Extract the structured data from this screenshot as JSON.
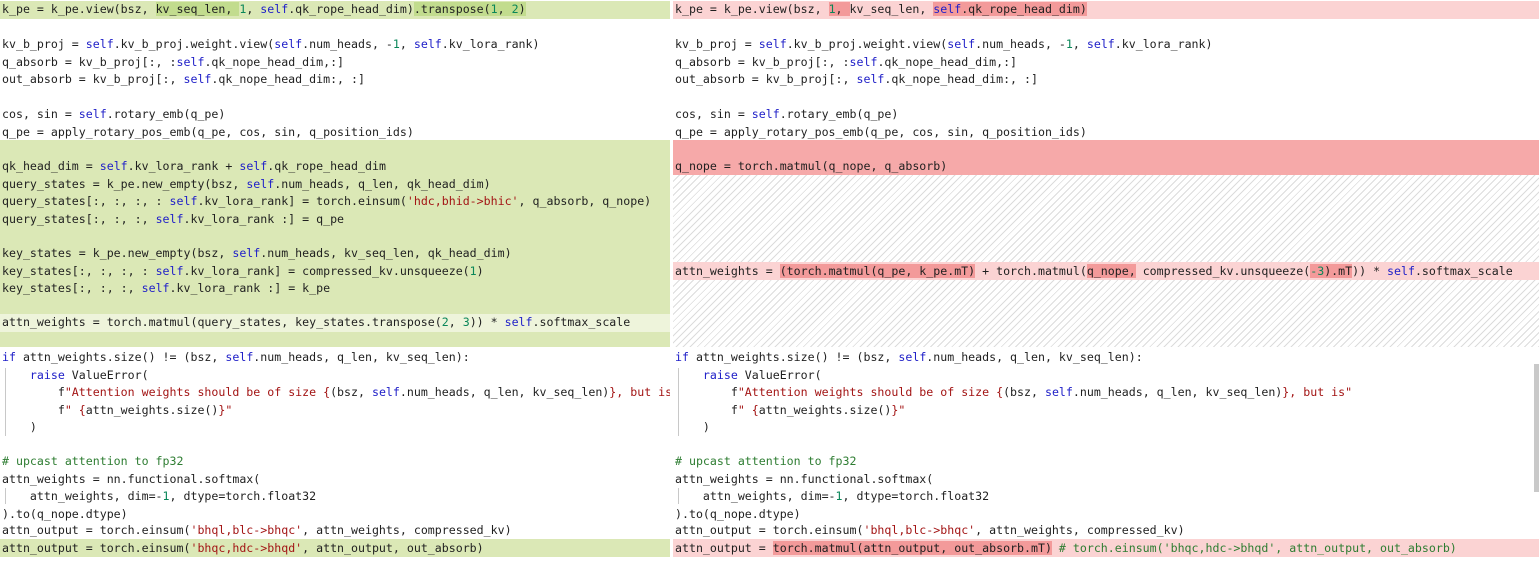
{
  "left_lines": [
    "k_pe = k_pe.view(bsz, kv_seq_len, 1, self.qk_rope_head_dim).transpose(1, 2)",
    "",
    "kv_b_proj = self.kv_b_proj.weight.view(self.num_heads, -1, self.kv_lora_rank)",
    "q_absorb = kv_b_proj[:, :self.qk_nope_head_dim,:]",
    "out_absorb = kv_b_proj[:, self.qk_nope_head_dim:, :]",
    "",
    "cos, sin = self.rotary_emb(q_pe)",
    "q_pe = apply_rotary_pos_emb(q_pe, cos, sin, q_position_ids)",
    "",
    "qk_head_dim = self.kv_lora_rank + self.qk_rope_head_dim",
    "query_states = k_pe.new_empty(bsz, self.num_heads, q_len, qk_head_dim)",
    "query_states[:, :, :, : self.kv_lora_rank] = torch.einsum('hdc,bhid->bhic', q_absorb, q_nope)",
    "query_states[:, :, :, self.kv_lora_rank :] = q_pe",
    "",
    "key_states = k_pe.new_empty(bsz, self.num_heads, kv_seq_len, qk_head_dim)",
    "key_states[:, :, :, : self.kv_lora_rank] = compressed_kv.unsqueeze(1)",
    "key_states[:, :, :, self.kv_lora_rank :] = k_pe",
    "",
    "attn_weights = torch.matmul(query_states, key_states.transpose(2, 3)) * self.softmax_scale",
    "",
    "if attn_weights.size() != (bsz, self.num_heads, q_len, kv_seq_len):",
    "    raise ValueError(",
    "        f\"Attention weights should be of size {(bsz, self.num_heads, q_len, kv_seq_len)}, but is\"",
    "        f\" {attn_weights.size()}\"",
    "    )",
    "",
    "# upcast attention to fp32",
    "attn_weights = nn.functional.softmax(",
    "    attn_weights, dim=-1, dtype=torch.float32",
    ").to(q_nope.dtype)",
    "attn_output = torch.einsum('bhql,blc->bhqc', attn_weights, compressed_kv)",
    "attn_output = torch.einsum('bhqc,hdc->bhqd', attn_output, out_absorb)"
  ],
  "right_lines": [
    "k_pe = k_pe.view(bsz, 1, kv_seq_len, self.qk_rope_head_dim)",
    "",
    "kv_b_proj = self.kv_b_proj.weight.view(self.num_heads, -1, self.kv_lora_rank)",
    "q_absorb = kv_b_proj[:, :self.qk_nope_head_dim,:]",
    "out_absorb = kv_b_proj[:, self.qk_nope_head_dim:, :]",
    "",
    "cos, sin = self.rotary_emb(q_pe)",
    "q_pe = apply_rotary_pos_emb(q_pe, cos, sin, q_position_ids)",
    "",
    "q_nope = torch.matmul(q_nope, q_absorb)",
    "attn_weights = (torch.matmul(q_pe, k_pe.mT) + torch.matmul(q_nope, compressed_kv.unsqueeze(-3).mT)) * self.softmax_scale",
    "if attn_weights.size() != (bsz, self.num_heads, q_len, kv_seq_len):",
    "    raise ValueError(",
    "        f\"Attention weights should be of size {(bsz, self.num_heads, q_len, kv_seq_len)}, but is\"",
    "        f\" {attn_weights.size()}\"",
    "    )",
    "",
    "# upcast attention to fp32",
    "attn_weights = nn.functional.softmax(",
    "    attn_weights, dim=-1, dtype=torch.float32",
    ").to(q_nope.dtype)",
    "attn_output = torch.einsum('bhql,blc->bhqc', attn_weights, compressed_kv)",
    "attn_output = torch.matmul(attn_output, out_absorb.mT) # torch.einsum('bhqc,hdc->bhqd', attn_output, out_absorb)"
  ]
}
